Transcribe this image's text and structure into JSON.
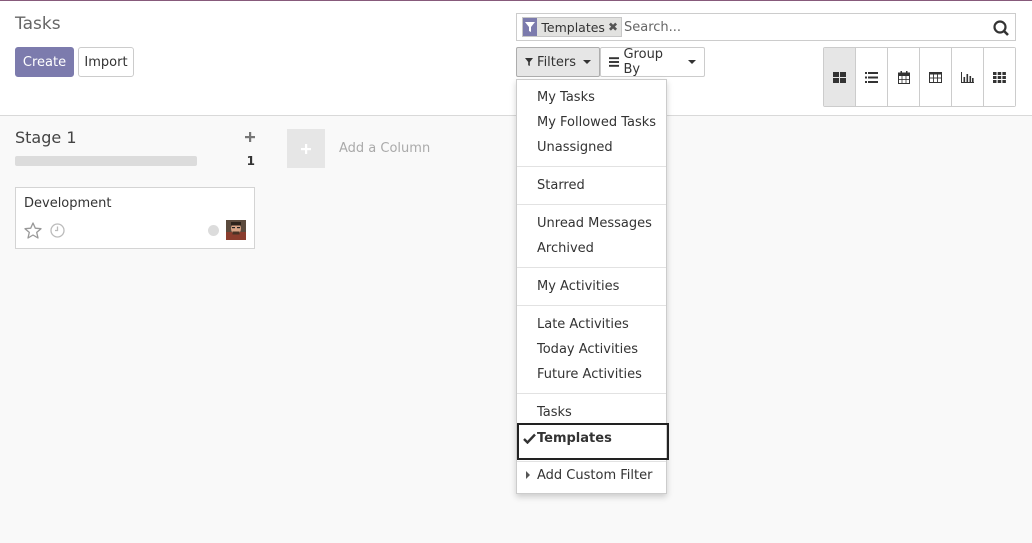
{
  "page": {
    "title": "Tasks",
    "accent": "#7c7bad"
  },
  "buttons": {
    "create": "Create",
    "import": "Import"
  },
  "search": {
    "facet_label": "Templates",
    "placeholder": "Search...",
    "icon": "search-icon"
  },
  "toolbar": {
    "filters_label": "Filters",
    "groupby_label": "Group By"
  },
  "views": [
    "kanban",
    "list",
    "calendar",
    "pivot",
    "graph",
    "grid"
  ],
  "kanban": {
    "column": {
      "title": "Stage 1",
      "count": "1",
      "cards": [
        {
          "title": "Development",
          "starred": false
        }
      ]
    },
    "add_column_label": "Add a Column"
  },
  "filters_menu": {
    "groups": [
      [
        "My Tasks",
        "My Followed Tasks",
        "Unassigned"
      ],
      [
        "Starred"
      ],
      [
        "Unread Messages",
        "Archived"
      ],
      [
        "My Activities"
      ],
      [
        "Late Activities",
        "Today Activities",
        "Future Activities"
      ],
      [
        "Tasks",
        "Templates"
      ]
    ],
    "selected": "Templates",
    "custom_filter_label": "Add Custom Filter"
  }
}
